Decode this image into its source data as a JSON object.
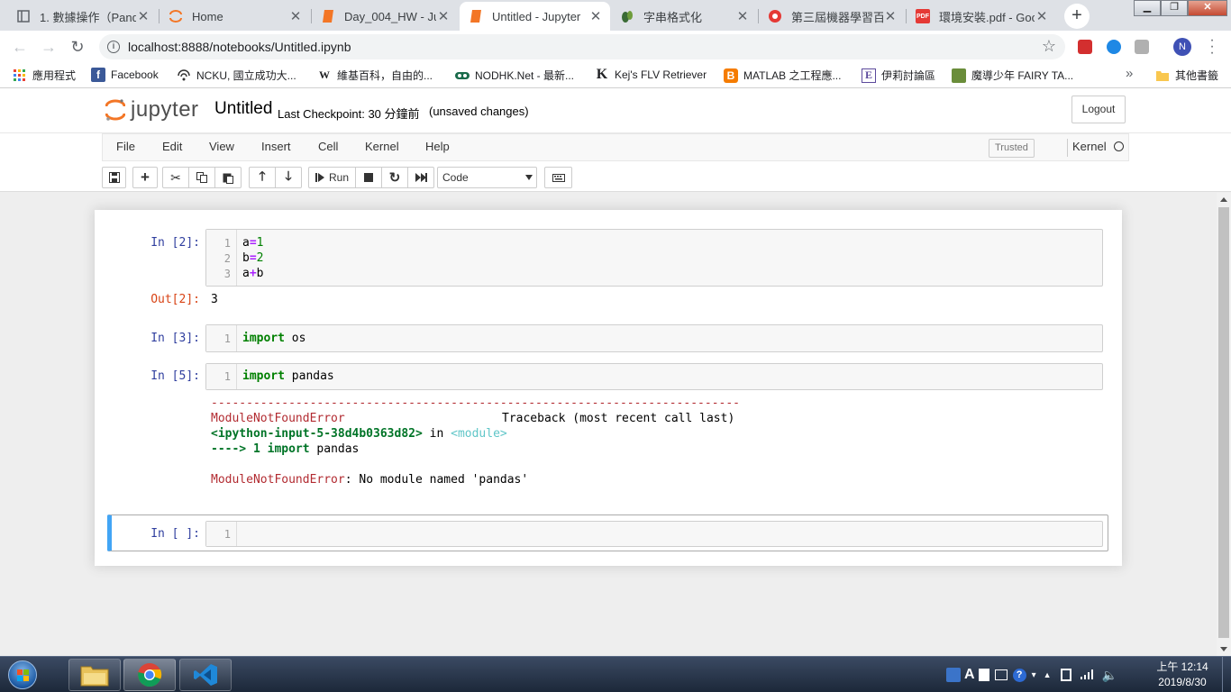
{
  "browser": {
    "tabs": [
      {
        "title": "1. 數據操作（Pand",
        "icon": "pages-icon"
      },
      {
        "title": "Home",
        "icon": "jupyter-icon"
      },
      {
        "title": "Day_004_HW - Jup",
        "icon": "notebook-icon"
      },
      {
        "title": "Untitled - Jupyter",
        "icon": "notebook-icon",
        "active": true
      },
      {
        "title": "字串格式化",
        "icon": "leaf-icon"
      },
      {
        "title": "第三屆機器學習百日",
        "icon": "cupoy-icon"
      },
      {
        "title": "環境安裝.pdf - Goo",
        "icon": "pdf-icon"
      }
    ],
    "url": "localhost:8888/notebooks/Untitled.ipynb",
    "profile_initial": "N",
    "bookmarks": [
      {
        "label": "應用程式",
        "icon": "apps-grid-icon"
      },
      {
        "label": "Facebook",
        "icon": "facebook-icon"
      },
      {
        "label": "NCKU, 國立成功大...",
        "icon": "ncku-icon"
      },
      {
        "label": "維基百科，自由的...",
        "icon": "wikipedia-icon"
      },
      {
        "label": "NODHK.Net - 最新...",
        "icon": "nodhk-icon"
      },
      {
        "label": "Kej's FLV Retriever",
        "icon": "k-icon"
      },
      {
        "label": "MATLAB 之工程應...",
        "icon": "blogger-icon"
      },
      {
        "label": "伊莉討論區",
        "icon": "e-icon"
      },
      {
        "label": "魔導少年 FAIRY TA...",
        "icon": "manga-icon"
      }
    ],
    "more_bookmarks_glyph": "»",
    "other_bookmarks": "其他書籤"
  },
  "jupyter": {
    "logo_text": "jupyter",
    "notebook_name": "Untitled",
    "checkpoint": "Last Checkpoint: 30 分鐘前",
    "autosave": "(unsaved changes)",
    "logout": "Logout",
    "menu": [
      "File",
      "Edit",
      "View",
      "Insert",
      "Cell",
      "Kernel",
      "Help"
    ],
    "trusted": "Trusted",
    "kernel_label": "Kernel",
    "run_label": "Run",
    "cell_type": "Code"
  },
  "cells": {
    "c1": {
      "prompt": "In [2]:",
      "lines": [
        "1",
        "2",
        "3"
      ],
      "code_a": "a",
      "code_eq": "=",
      "code_1": "1",
      "code_b": "b",
      "code_2": "2",
      "code_plus_a": "a",
      "code_plus": "+",
      "code_plus_b": "b",
      "out_prompt": "Out[2]:",
      "output": "3"
    },
    "c2": {
      "prompt": "In [3]:",
      "line": "1",
      "keyword": "import",
      "module": "os"
    },
    "c3": {
      "prompt": "In [5]:",
      "line": "1",
      "keyword": "import",
      "module": "pandas",
      "tb_rule": "---------------------------------------------------------------------------",
      "tb_error": "ModuleNotFoundError",
      "tb_traceback": "Traceback (most recent call last)",
      "tb_input": "<ipython-input-5-38d4b0363d82>",
      "tb_in": " in ",
      "tb_module": "<module>",
      "tb_arrow": "----> 1 import pandas",
      "tb_error2": "ModuleNotFoundError",
      "tb_message": ": No module named 'pandas'"
    },
    "c4": {
      "prompt": "In [ ]:",
      "line": "1"
    }
  },
  "taskbar": {
    "time": "上午 12:14",
    "date": "2019/8/30",
    "apps": [
      "explorer-icon",
      "chrome-icon",
      "vscode-icon"
    ]
  },
  "colors": {
    "prompt_in": "#303f9f",
    "prompt_out": "#d84315",
    "selected_cell": "#42a5f5",
    "error_red": "#b22b31"
  }
}
